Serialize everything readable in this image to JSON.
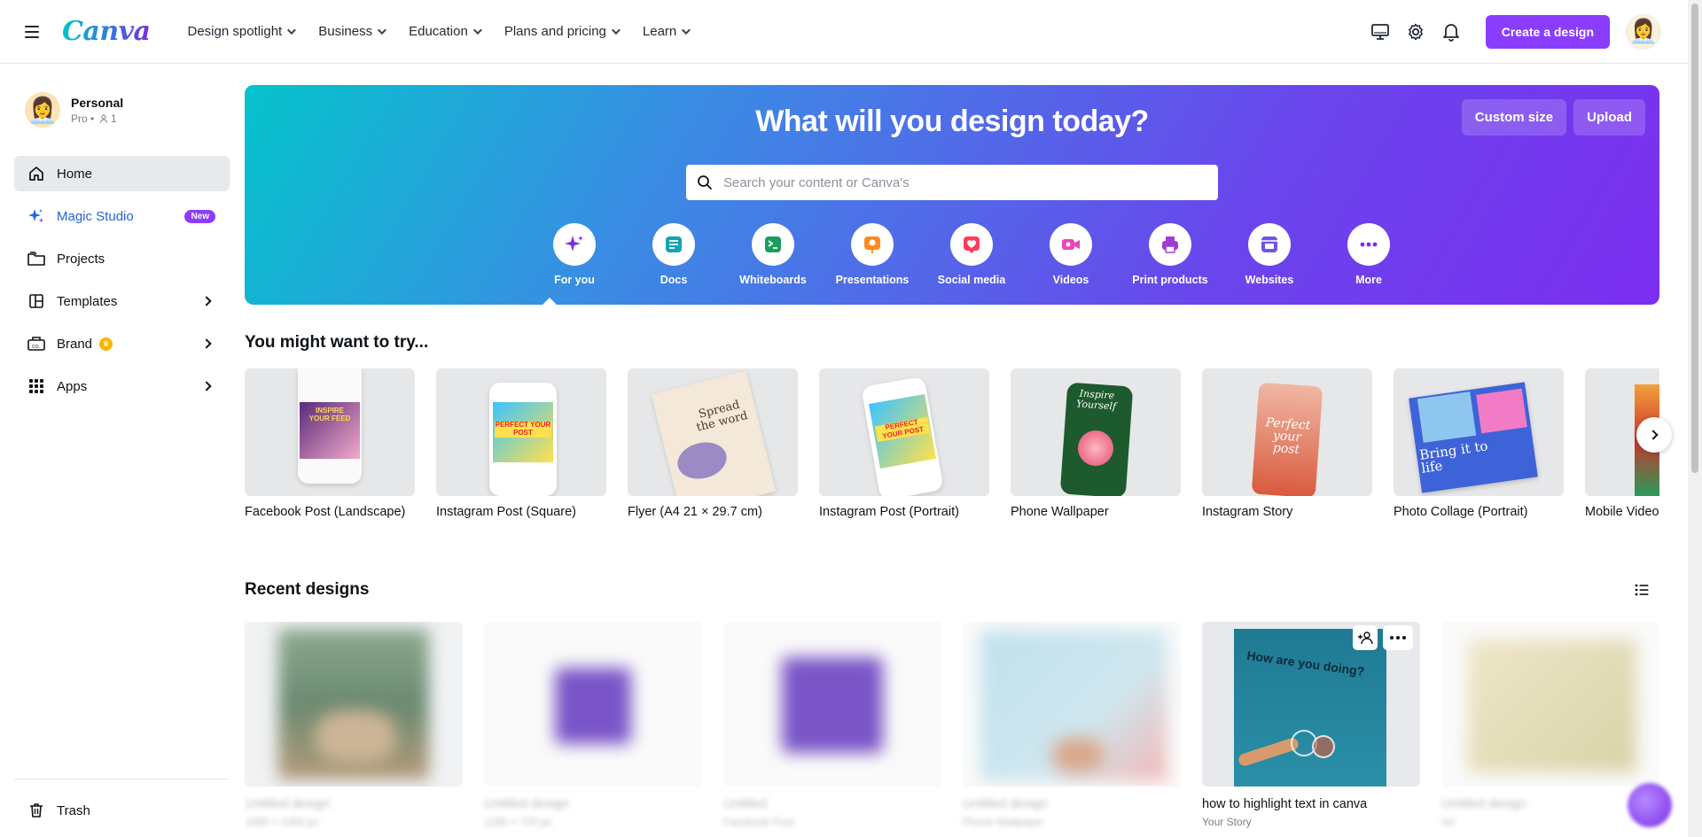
{
  "header": {
    "logo": "Canva",
    "nav": [
      {
        "label": "Design spotlight"
      },
      {
        "label": "Business"
      },
      {
        "label": "Education"
      },
      {
        "label": "Plans and pricing"
      },
      {
        "label": "Learn"
      }
    ],
    "create_label": "Create a design"
  },
  "sidebar": {
    "account_name": "Personal",
    "account_plan": "Pro •",
    "member_count": "1",
    "items": [
      {
        "label": "Home"
      },
      {
        "label": "Magic Studio",
        "badge": "New"
      },
      {
        "label": "Projects"
      },
      {
        "label": "Templates"
      },
      {
        "label": "Brand"
      },
      {
        "label": "Apps"
      }
    ],
    "trash_label": "Trash"
  },
  "hero": {
    "title": "What will you design today?",
    "custom_size": "Custom size",
    "upload": "Upload",
    "search_placeholder": "Search your content or Canva's",
    "categories": [
      {
        "label": "For you",
        "icon": "sparkle-icon",
        "color": "#7d2ae8"
      },
      {
        "label": "Docs",
        "icon": "doc-icon",
        "color": "#13a3b5"
      },
      {
        "label": "Whiteboards",
        "icon": "whiteboard-icon",
        "color": "#1a9e5c"
      },
      {
        "label": "Presentations",
        "icon": "presentation-icon",
        "color": "#ff8a1f"
      },
      {
        "label": "Social media",
        "icon": "heart-icon",
        "color": "#ff3b57"
      },
      {
        "label": "Videos",
        "icon": "video-icon",
        "color": "#e946b8"
      },
      {
        "label": "Print products",
        "icon": "printer-icon",
        "color": "#a23bd6"
      },
      {
        "label": "Websites",
        "icon": "website-icon",
        "color": "#6a57e8"
      },
      {
        "label": "More",
        "icon": "more-icon",
        "color": "#7d2ae8"
      }
    ]
  },
  "try_section": {
    "title": "You might want to try...",
    "items": [
      {
        "label": "Facebook Post (Landscape)",
        "thumb_text": "INSPIRE YOUR FEED"
      },
      {
        "label": "Instagram Post (Square)",
        "thumb_text": "PERFECT YOUR POST"
      },
      {
        "label": "Flyer (A4 21 × 29.7 cm)",
        "thumb_text": "Spread the word"
      },
      {
        "label": "Instagram Post (Portrait)",
        "thumb_text": "PERFECT YOUR POST"
      },
      {
        "label": "Phone Wallpaper",
        "thumb_text": "Inspire Yourself"
      },
      {
        "label": "Instagram Story",
        "thumb_text": "Perfect your post"
      },
      {
        "label": "Photo Collage (Portrait)",
        "thumb_text": "Bring it to life"
      },
      {
        "label": "Mobile Video",
        "thumb_text": ""
      }
    ]
  },
  "recent": {
    "title": "Recent designs",
    "items": [
      {
        "title": "Untitled design",
        "sub": "1080 × 1350 px",
        "blurred": true
      },
      {
        "title": "Untitled design",
        "sub": "1280 × 720 px",
        "blurred": true
      },
      {
        "title": "Untitled",
        "sub": "Facebook Post",
        "blurred": true
      },
      {
        "title": "Untitled design",
        "sub": "Phone Wallpaper",
        "blurred": true
      },
      {
        "title": "how to highlight text in canva",
        "sub": "Your Story",
        "blurred": false,
        "thumb_text": "How are you doing?"
      },
      {
        "title": "Untitled design",
        "sub": "A4",
        "blurred": true
      }
    ]
  }
}
